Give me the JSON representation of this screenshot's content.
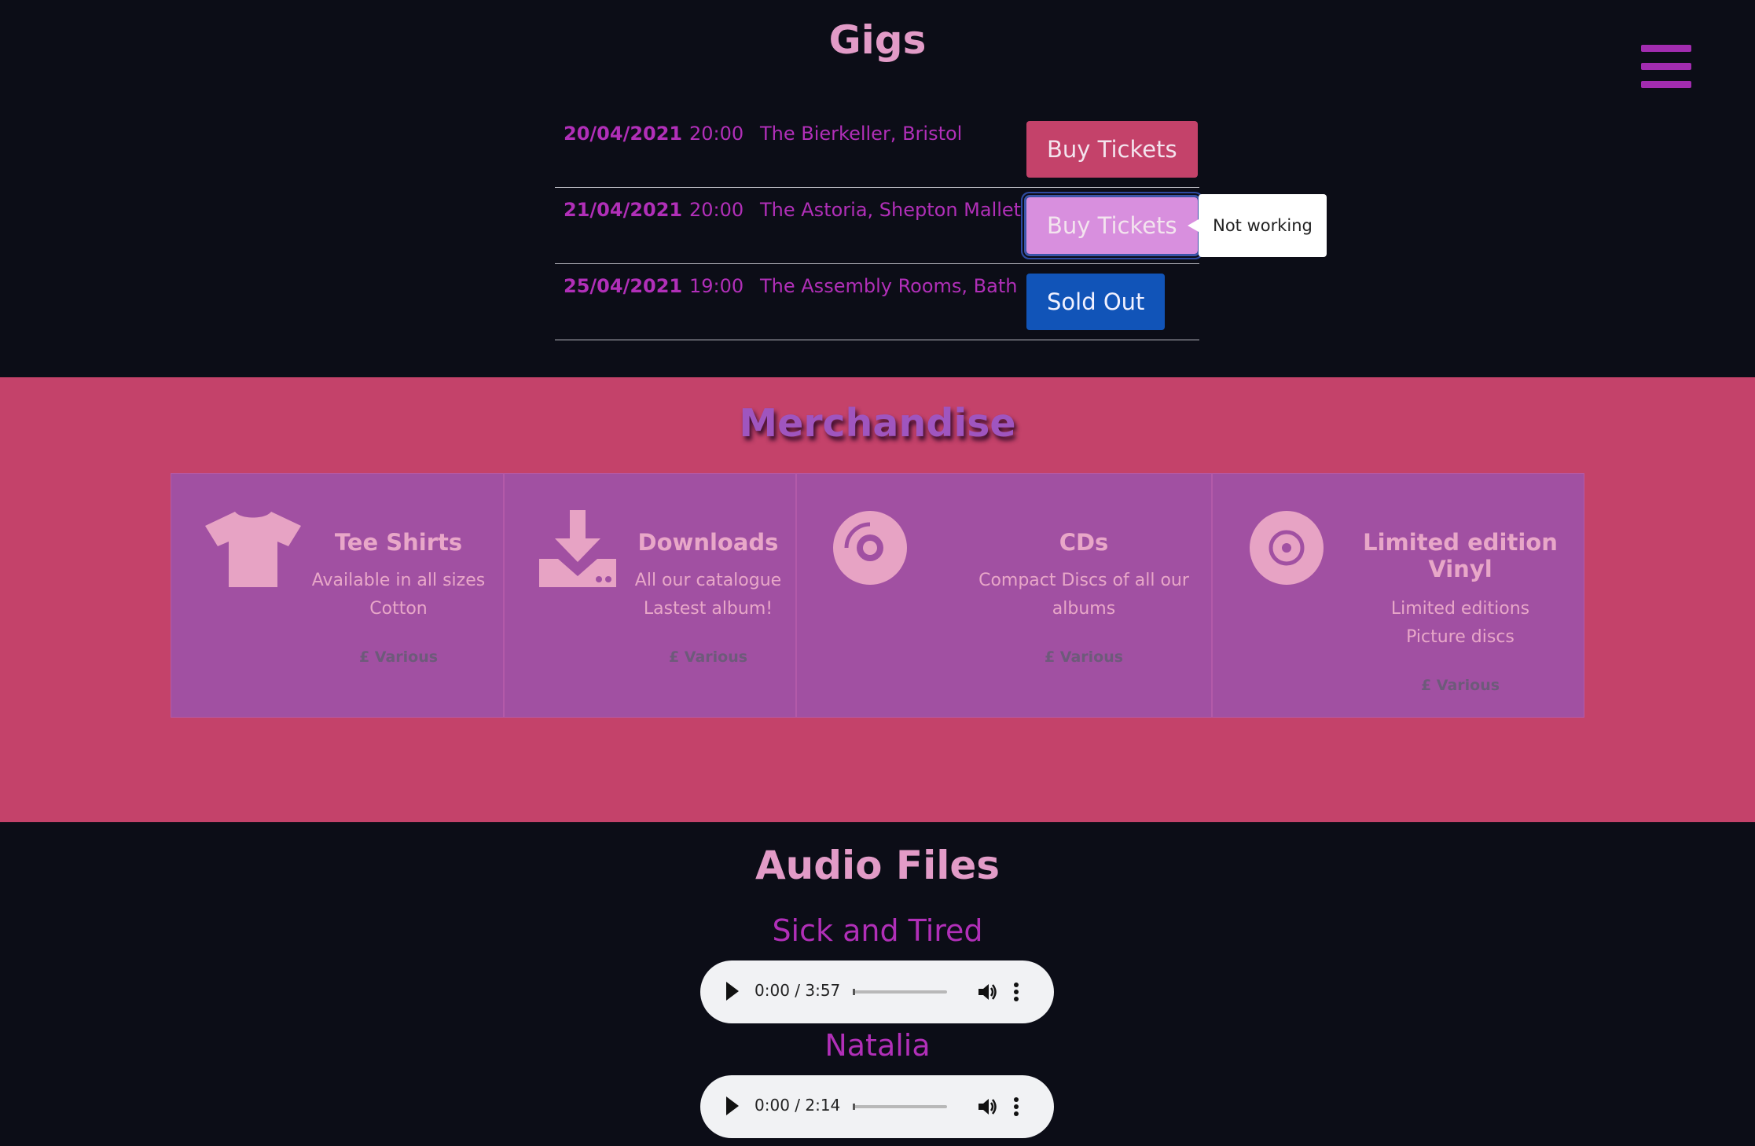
{
  "menu": {
    "icon": "hamburger-menu-icon"
  },
  "gigs": {
    "title": "Gigs",
    "rows": [
      {
        "date": "20/04/2021",
        "time": "20:00",
        "venue": "The Bierkeller, Bristol",
        "button": "Buy Tickets"
      },
      {
        "date": "21/04/2021",
        "time": "20:00",
        "venue": "The Astoria, Shepton Mallett",
        "button": "Buy Tickets"
      },
      {
        "date": "25/04/2021",
        "time": "19:00",
        "venue": "The Assembly Rooms, Bath",
        "button": "Sold Out"
      }
    ],
    "tooltip": "Not working"
  },
  "merch": {
    "title": "Merchandise",
    "cards": [
      {
        "icon": "tshirt-icon",
        "title": "Tee Shirts",
        "desc1": "Available in all sizes",
        "desc2": "Cotton",
        "price": "£ Various"
      },
      {
        "icon": "download-icon",
        "title": "Downloads",
        "desc1": "All our catalogue",
        "desc2": "Lastest album!",
        "price": "£ Various"
      },
      {
        "icon": "cd-icon",
        "title": "CDs",
        "desc1": "Compact Discs of all our",
        "desc2": "albums",
        "price": "£ Various"
      },
      {
        "icon": "vinyl-record-icon",
        "title1": "Limited edition",
        "title2": "Vinyl",
        "desc1": "Limited editions",
        "desc2": "Picture discs",
        "price": "£ Various"
      }
    ]
  },
  "audio": {
    "title": "Audio Files",
    "tracks": [
      {
        "title": "Sick and Tired",
        "time": "0:00 / 3:57"
      },
      {
        "title": "Natalia",
        "time": "0:00 / 2:14"
      }
    ]
  },
  "colors": {
    "background": "#0c0d17",
    "heading": "#e29bc7",
    "accent": "#b12fb8",
    "merch_bg": "#c4426a",
    "card_bg": "#a150a2",
    "buy_button": "#c4426a",
    "sold_out_button": "#1154b8"
  }
}
